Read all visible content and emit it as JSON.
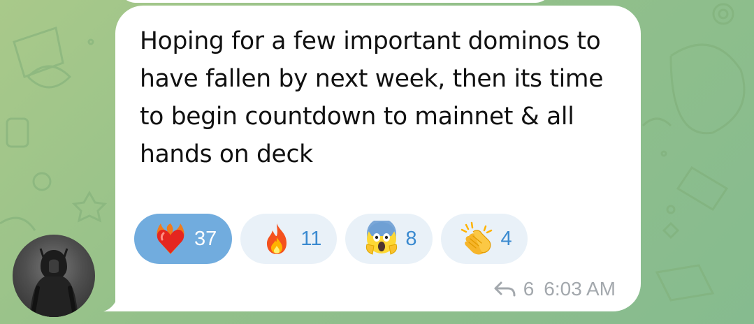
{
  "message": {
    "text": "Hoping for a few important dominos to have fallen by next week, then its time to begin countdown to mainnet & all hands on deck",
    "reply_count": "6",
    "time": "6:03 AM"
  },
  "reactions": [
    {
      "icon": "heart-on-fire-icon",
      "count": "37",
      "chosen": true
    },
    {
      "icon": "fire-icon",
      "count": "11",
      "chosen": false
    },
    {
      "icon": "screaming-face-icon",
      "count": "8",
      "chosen": false
    },
    {
      "icon": "clapping-hands-icon",
      "count": "4",
      "chosen": false
    }
  ],
  "colors": {
    "bubble": "#ffffff",
    "reaction_chosen": "#71acde",
    "reaction_default": "#e9f1f8",
    "reaction_count": "#3a8ad0",
    "meta_text": "#a3a8ad",
    "background": "#93c08a"
  },
  "sender": {
    "avatar_icon": "hooded-figure-avatar"
  }
}
